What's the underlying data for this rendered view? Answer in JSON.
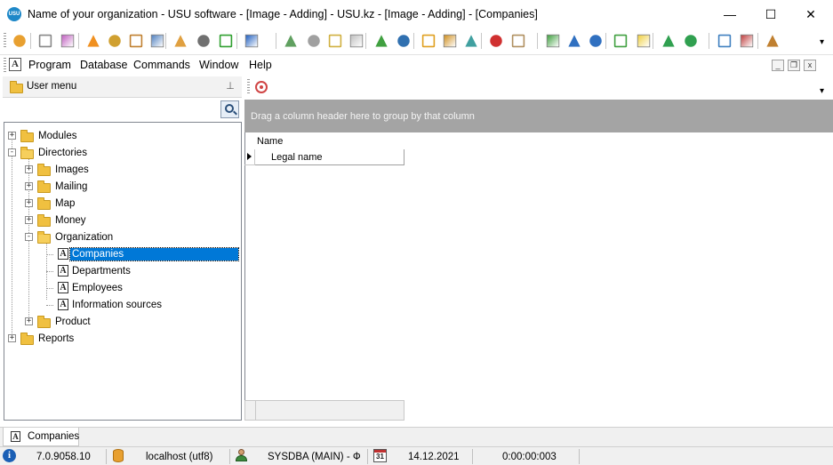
{
  "window": {
    "logo_text": "USU",
    "title": "Name of your organization - USU software - [Image - Adding] - USU.kz - [Image - Adding] - [Companies]",
    "minimize_glyph": "—",
    "maximize_glyph": "☐",
    "close_glyph": "✕"
  },
  "toolbar": {
    "overflow_glyph": "▾",
    "icons": [
      "location-pin-icon",
      "gear-icon",
      "color-wheel-icon",
      "rss-icon",
      "lock-icon",
      "users-icon",
      "plugin-icon",
      "table-icon",
      "printer-icon",
      "play-icon",
      "info-icon",
      "add-record-icon",
      "copy-record-icon",
      "edit-record-icon",
      "delete-record-icon",
      "refresh-icon",
      "search-icon",
      "filter-icon",
      "clear-filter-icon",
      "filter-check-icon",
      "flag-icon",
      "image-icon",
      "move-icon",
      "collapse-icon",
      "expand-icon",
      "insert-column-icon",
      "sticky-note-icon",
      "export-excel-icon",
      "import-excel-icon",
      "window-new-icon",
      "window-close-icon",
      "exit-icon"
    ]
  },
  "menubar": {
    "app_icon_letter": "A",
    "items": [
      "Program",
      "Database",
      "Commands",
      "Window",
      "Help"
    ],
    "mdi_minimize": "_",
    "mdi_restore": "❐",
    "mdi_close": "x"
  },
  "left_panel": {
    "title": "User menu",
    "pin_glyph": "⊥",
    "tree": [
      {
        "label": "Modules",
        "level": 0,
        "type": "folder",
        "expander": "+"
      },
      {
        "label": "Directories",
        "level": 0,
        "type": "folder-open",
        "expander": "-"
      },
      {
        "label": "Images",
        "level": 1,
        "type": "folder",
        "expander": "+"
      },
      {
        "label": "Mailing",
        "level": 1,
        "type": "folder",
        "expander": "+"
      },
      {
        "label": "Map",
        "level": 1,
        "type": "folder",
        "expander": "+"
      },
      {
        "label": "Money",
        "level": 1,
        "type": "folder",
        "expander": "+"
      },
      {
        "label": "Organization",
        "level": 1,
        "type": "folder-open",
        "expander": "-"
      },
      {
        "label": "Companies",
        "level": 2,
        "type": "doc",
        "selected": true
      },
      {
        "label": "Departments",
        "level": 2,
        "type": "doc"
      },
      {
        "label": "Employees",
        "level": 2,
        "type": "doc"
      },
      {
        "label": "Information sources",
        "level": 2,
        "type": "doc"
      },
      {
        "label": "Product",
        "level": 1,
        "type": "folder",
        "expander": "+"
      },
      {
        "label": "Reports",
        "level": 0,
        "type": "folder",
        "expander": "+"
      }
    ],
    "doc_icon_letter": "A"
  },
  "grid": {
    "group_hint": "Drag a column header here to group by that column",
    "column_header": "Name",
    "rows": [
      "Legal name"
    ],
    "overflow_glyph": "▾"
  },
  "tabs": [
    {
      "label": "Companies",
      "icon_letter": "A"
    }
  ],
  "status": {
    "info_glyph": "i",
    "version": "7.0.9058.10",
    "connection": "localhost (utf8)",
    "user": "SYSDBA (MAIN) - Ф",
    "calendar_day": "31",
    "date": "14.12.2021",
    "timer": "0:00:00:003"
  }
}
